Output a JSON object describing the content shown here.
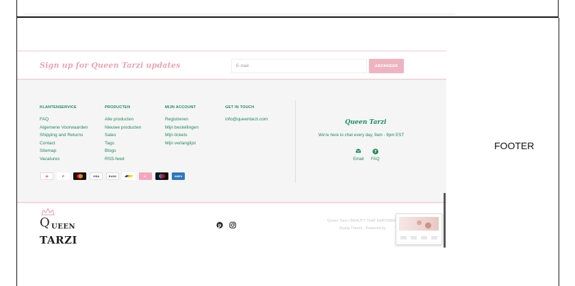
{
  "signup": {
    "title": "Sign up for Queen Tarzi updates",
    "email_placeholder": "E-mail",
    "subscribe_label": "ABONNEER"
  },
  "columns": [
    {
      "heading": "KLANTENSERVICE",
      "items": [
        "FAQ",
        "Algemene Voorwaarden",
        "Shipping and Returns",
        "Contact",
        "Sitemap",
        "Vacatures"
      ]
    },
    {
      "heading": "PRODUCTEN",
      "items": [
        "Alle producten",
        "Nieuwe producten",
        "Sales",
        "Tags",
        "Blogs",
        "RSS-feed"
      ]
    },
    {
      "heading": "MIJN ACCOUNT",
      "items": [
        "Registreren",
        "Mijn bestellingen",
        "Mijn tickets",
        "Mijn verlanglijst"
      ]
    },
    {
      "heading": "GET IN TOUCH",
      "items": [
        "info@queentarzi.com"
      ]
    }
  ],
  "contact": {
    "brand": "Queen Tarzi",
    "tagline": "We're here to chat every day, 9am - 9pm EST",
    "email_label": "Email",
    "faq_label": "FAQ"
  },
  "payments": [
    {
      "icon": "ideal-icon",
      "label": "iD",
      "color": "#cc0066"
    },
    {
      "icon": "paypal-icon",
      "label": "P",
      "color": "#253b80"
    },
    {
      "icon": "mastercard-icon",
      "label": "MC",
      "color": "#eb001b"
    },
    {
      "icon": "visa-icon",
      "label": "VISA",
      "color": "#1a1f71"
    },
    {
      "icon": "bank-icon",
      "label": "BANK",
      "color": "#444444"
    },
    {
      "icon": "bancontact-icon",
      "label": "BC",
      "color": "#1e3764"
    },
    {
      "icon": "klarna-icon",
      "label": "K.",
      "color": "#f04a7c"
    },
    {
      "icon": "maestro-icon",
      "label": "MA",
      "color": "#0099df"
    },
    {
      "icon": "amex-icon",
      "label": "AMEX",
      "color": "#2e77bc"
    }
  ],
  "bottom": {
    "logo_q": "Q",
    "logo_queen": "UEEN",
    "logo_tarzi": "TARZI",
    "copyright": "Queen Tarzi | BEAUTY THAT EMPOWERS",
    "powered_by": "Avalla Theme · Powered by"
  },
  "side_label": "FOOTER",
  "colors": {
    "accent_green": "#1c8a5a",
    "pink": "#eeb4c0",
    "pink_title": "#e9a5b2",
    "footer_bg": "#f5f5f5"
  }
}
